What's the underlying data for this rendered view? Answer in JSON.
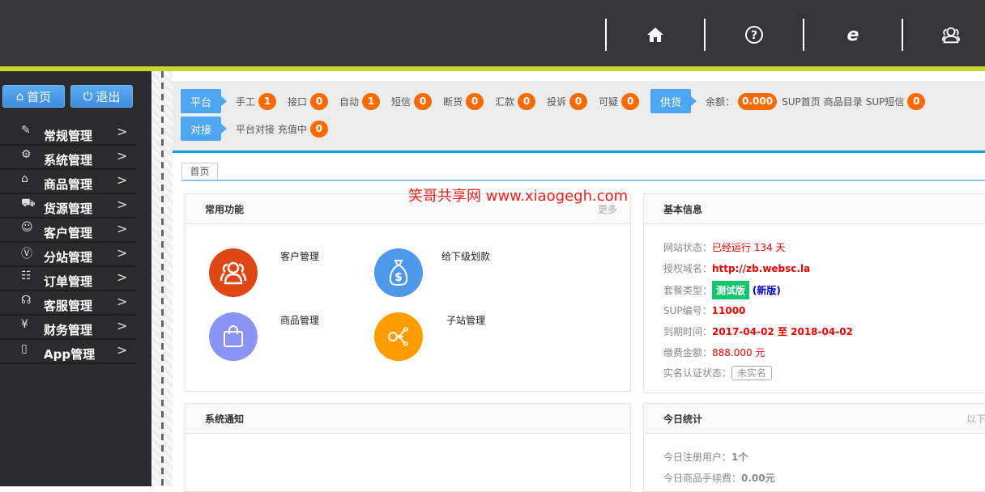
{
  "header": {
    "icons": [
      "home-icon",
      "help-icon",
      "ie-browser-icon",
      "users-icon"
    ]
  },
  "sidebar": {
    "home_button": "首页",
    "logout_button": "退出",
    "items": [
      {
        "label": "常规管理",
        "icon": "edit-icon"
      },
      {
        "label": "系统管理",
        "icon": "gear-icon"
      },
      {
        "label": "商品管理",
        "icon": "bag-icon"
      },
      {
        "label": "货源管理",
        "icon": "truck-icon"
      },
      {
        "label": "客户管理",
        "icon": "user-icon"
      },
      {
        "label": "分站管理",
        "icon": "vip-icon"
      },
      {
        "label": "订单管理",
        "icon": "clipboard-icon"
      },
      {
        "label": "客服管理",
        "icon": "support-icon"
      },
      {
        "label": "财务管理",
        "icon": "yuan-icon"
      },
      {
        "label": "App管理",
        "icon": "phone-icon"
      }
    ]
  },
  "notice": {
    "platform_tag": "平台",
    "platform_items": [
      {
        "label": "手工",
        "count": "1"
      },
      {
        "label": "接口",
        "count": "0"
      },
      {
        "label": "自动",
        "count": "1"
      },
      {
        "label": "短信",
        "count": "0"
      },
      {
        "label": "断货",
        "count": "0"
      },
      {
        "label": "汇款",
        "count": "0"
      },
      {
        "label": "投诉",
        "count": "0"
      },
      {
        "label": "可疑",
        "count": "0"
      }
    ],
    "supply_tag": "供货",
    "balance_label": "余额：",
    "balance": "0.000",
    "sup_home": "SUP首页",
    "catalog": "商品目录",
    "sup_sms": "SUP短信",
    "sup_sms_count": "0",
    "dock_tag": "对接",
    "dock_label": "平台对接 充值中",
    "dock_count": "0"
  },
  "tabs": [
    {
      "label": "首页"
    }
  ],
  "watermark": "笑哥共享网  www.xiaogegh.com",
  "common": {
    "title": "常用功能",
    "more": "更多",
    "items": [
      {
        "label": "客户管理",
        "color": "#dd4814",
        "icon": "users-icon"
      },
      {
        "label": "给下级划款",
        "color": "#4f97ea",
        "icon": "money-bag-icon"
      },
      {
        "label": "商品管理",
        "color": "#8b93f5",
        "icon": "shopping-bag-icon"
      },
      {
        "label": "子站管理",
        "color": "#ff9c00",
        "icon": "share-icon"
      }
    ]
  },
  "basic": {
    "title": "基本信息",
    "status_label": "网站状态：",
    "status": "已经运行 134 天",
    "domain_label": "授权域名：",
    "domain": "http://zb.websc.la",
    "plan_label": "套餐类型：",
    "plan": "测试版",
    "plan_note": "(新版)",
    "sup_label": "SUP编号：",
    "sup": "11000",
    "expire_label": "到期时间：",
    "expire": "2017-04-02 至 2018-04-02",
    "fee_label": "缴费金额：",
    "fee": "888.000 元",
    "verify_label": "实名认证状态：",
    "verify": "未实名"
  },
  "notice_panel": {
    "title": "系统通知"
  },
  "today": {
    "title": "今日统计",
    "more": "以下",
    "users_label": "今日注册用户：",
    "users": "1个",
    "fee_label": "今日商品手续费：",
    "fee": "0.00元"
  }
}
